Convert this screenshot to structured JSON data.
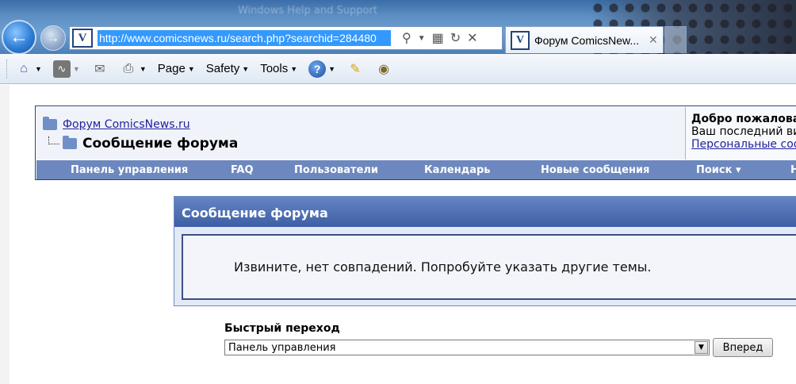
{
  "browser": {
    "faded_window_title": "Windows Help and Support",
    "address_url": "http://www.comicsnews.ru/search.php?searchid=284480",
    "site_icon_glyph": "V",
    "tab_title": "Форум ComicsNew...",
    "tab_close": "✕"
  },
  "commandbar": {
    "page_label": "Page",
    "safety_label": "Safety",
    "tools_label": "Tools",
    "help_glyph": "?"
  },
  "forum": {
    "breadcrumb_root": "Форум ComicsNews.ru",
    "breadcrumb_current": "Сообщение форума",
    "welcome_title": "Добро пожалова",
    "welcome_last_visit": "Ваш последний ви",
    "welcome_link": "Персональные соо",
    "nav": {
      "control_panel": "Панель управления",
      "faq": "FAQ",
      "members": "Пользователи",
      "calendar": "Календарь",
      "new_posts": "Новые сообщения",
      "search": "Поиск ▾",
      "more": "Н"
    },
    "message_title": "Сообщение форума",
    "message_text": "Извините, нет совпадений. Попробуйте указать другие темы.",
    "quick_nav_label": "Быстрый переход",
    "quick_nav_selected": "Панель управления",
    "quick_nav_button": "Вперед"
  }
}
